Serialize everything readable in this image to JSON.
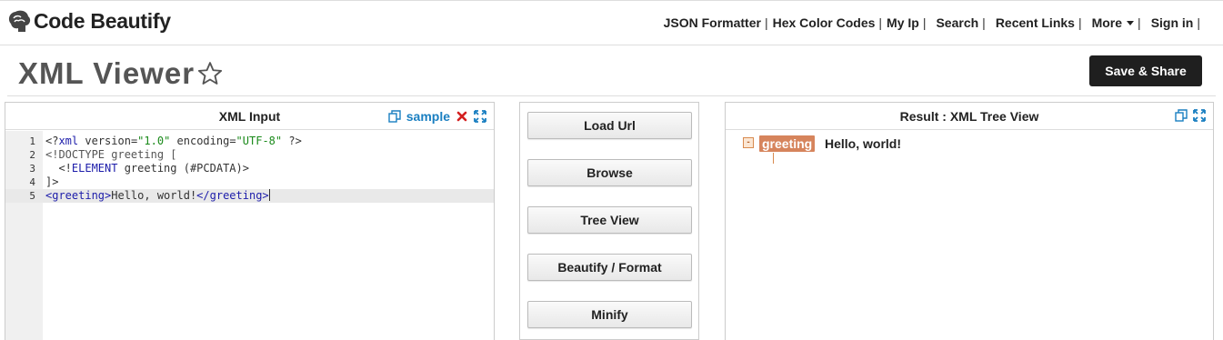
{
  "header": {
    "logo_text": "Code Beautify",
    "nav": [
      {
        "label": "JSON Formatter"
      },
      {
        "label": "Hex Color Codes"
      },
      {
        "label": "My Ip"
      },
      {
        "label": "Search"
      },
      {
        "label": "Recent Links"
      },
      {
        "label": "More"
      },
      {
        "label": "Sign in"
      }
    ]
  },
  "page": {
    "title": "XML Viewer",
    "save_label": "Save & Share"
  },
  "input_panel": {
    "title": "XML Input",
    "sample_label": "sample",
    "lines": [
      {
        "num": "1",
        "text": "<?xml version=\"1.0\" encoding=\"UTF-8\" ?>"
      },
      {
        "num": "2",
        "text": "<!DOCTYPE greeting ["
      },
      {
        "num": "3",
        "text": "  <!ELEMENT greeting (#PCDATA)>"
      },
      {
        "num": "4",
        "text": "]>"
      },
      {
        "num": "5",
        "text": "<greeting>Hello, world!</greeting>"
      }
    ]
  },
  "actions": {
    "load_url": "Load Url",
    "browse": "Browse",
    "tree_view": "Tree View",
    "beautify": "Beautify / Format",
    "minify": "Minify"
  },
  "result_panel": {
    "title": "Result : XML Tree View",
    "toggle_symbol": "-",
    "node_tag": "greeting",
    "node_value": "Hello, world!"
  },
  "colors": {
    "accent_link": "#1a7fc1",
    "tree_tag_bg": "#d6845c",
    "save_button_bg": "#1f1f1f"
  }
}
